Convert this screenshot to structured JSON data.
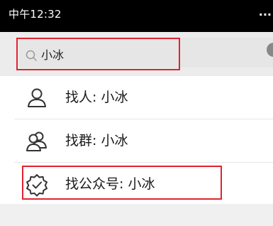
{
  "status_bar": {
    "time": "中午12:32",
    "more": "..."
  },
  "search": {
    "query": "小冰",
    "icon": "search-icon"
  },
  "results": [
    {
      "label": "找人: 小冰",
      "icon": "person-icon"
    },
    {
      "label": "找群: 小冰",
      "icon": "group-icon"
    },
    {
      "label": "找公众号: 小冰",
      "icon": "official-account-icon"
    }
  ],
  "colors": {
    "highlight": "#e0242f",
    "icon_stroke": "#333333"
  }
}
